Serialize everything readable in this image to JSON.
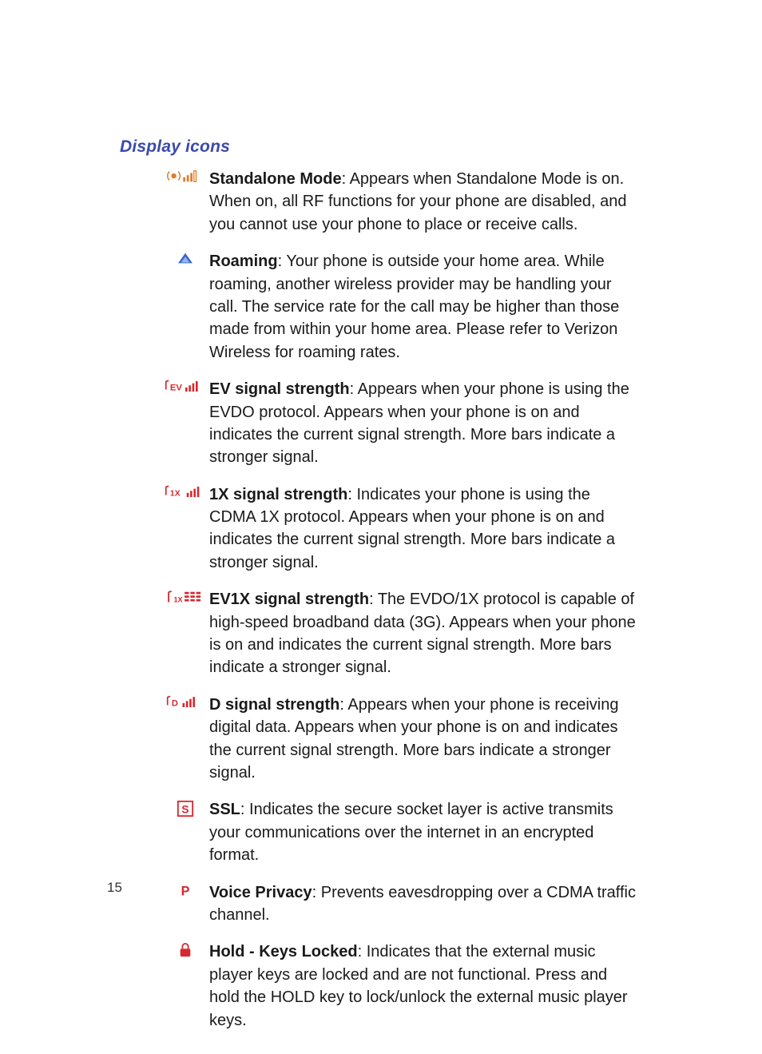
{
  "section_title": "Display icons",
  "page_number": "15",
  "entries": [
    {
      "icon": "standalone",
      "title": "Standalone Mode",
      "sep": ": ",
      "desc": "Appears when Standalone Mode is on. When on, all RF functions for your phone are disabled, and you cannot use your phone to place or receive calls."
    },
    {
      "icon": "roaming",
      "title": "Roaming",
      "sep": ": ",
      "desc": "Your phone is outside your home area. While roaming, another wireless provider may be handling your call. The service rate for the call may be higher than those made from within your home area. Please refer to Verizon Wireless for roaming rates."
    },
    {
      "icon": "ev",
      "title": "EV signal strength",
      "sep": ": ",
      "desc": "Appears when your phone is using the EVDO protocol.   Appears when your phone is on and indicates the current signal strength. More bars indicate a stronger signal."
    },
    {
      "icon": "onex",
      "title": "1X signal strength",
      "sep": ": ",
      "desc": "Indicates your phone is using the CDMA 1X protocol. Appears when your phone is on and indicates the current signal strength. More bars indicate a stronger signal."
    },
    {
      "icon": "ev1x",
      "title": "EV1X signal strength",
      "sep": ": ",
      "desc": "The EVDO/1X protocol is capable of high-speed broadband data (3G). Appears when your phone is on and indicates the current signal strength. More bars indicate a stronger signal."
    },
    {
      "icon": "d",
      "title": "D signal strength",
      "sep": ": ",
      "desc": "Appears when your phone is receiving digital data. Appears when your phone is on and indicates the current signal strength. More bars indicate a stronger signal."
    },
    {
      "icon": "ssl",
      "title": "SSL",
      "sep": ": ",
      "desc": "Indicates the secure socket layer is active transmits your communications over the internet in an encrypted format."
    },
    {
      "icon": "privacy",
      "title": "Voice Privacy",
      "sep": ": ",
      "desc": "Prevents eavesdropping over a CDMA traffic channel."
    },
    {
      "icon": "lock",
      "title": "Hold - Keys Locked",
      "sep": ": ",
      "desc": "Indicates that the external music player keys are locked and are not functional. Press and hold the HOLD key to lock/unlock the external music player keys."
    }
  ]
}
